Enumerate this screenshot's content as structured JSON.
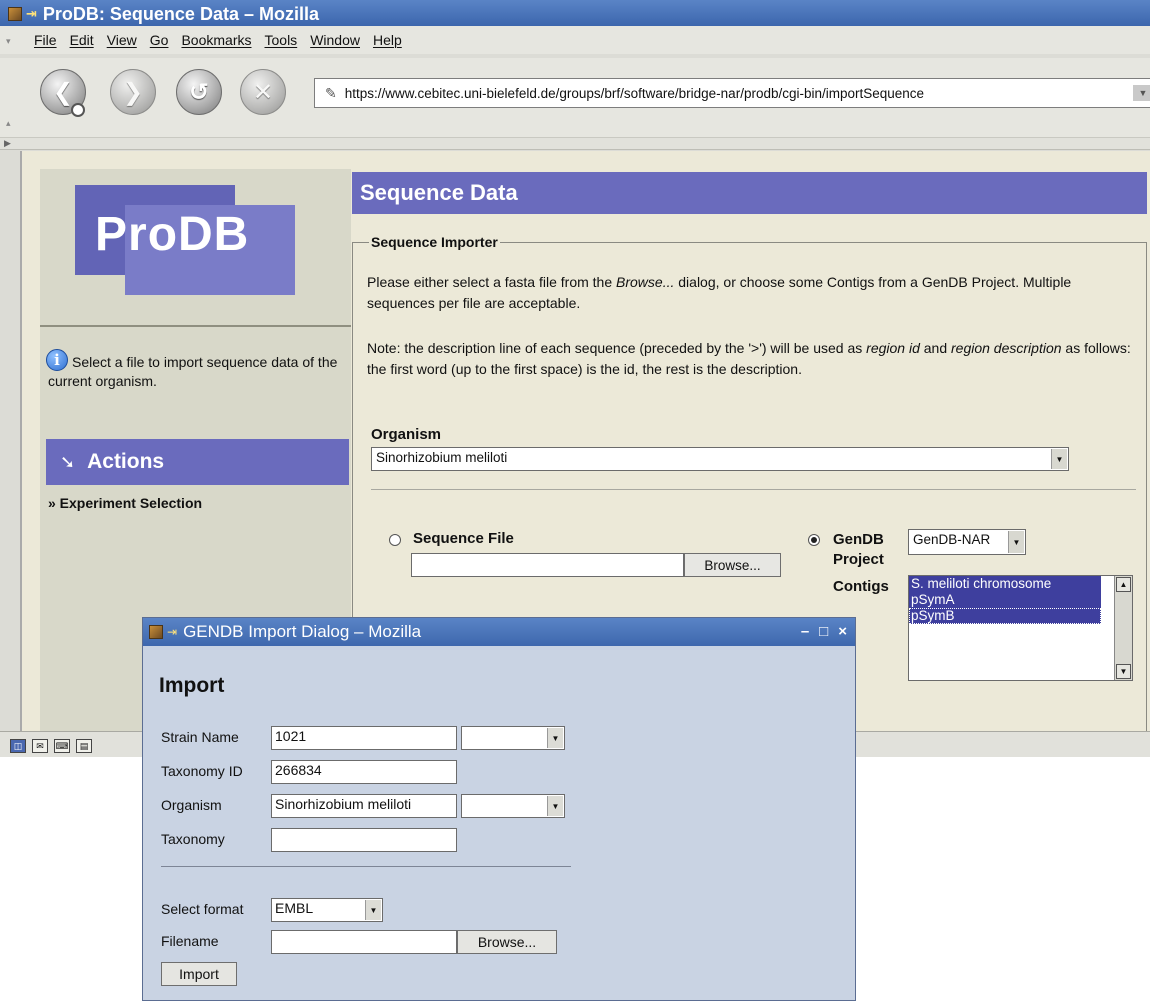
{
  "browser": {
    "title": "ProDB: Sequence Data – Mozilla",
    "menu": [
      "File",
      "Edit",
      "View",
      "Go",
      "Bookmarks",
      "Tools",
      "Window",
      "Help"
    ],
    "url": "https://www.cebitec.uni-bielefeld.de/groups/brf/software/bridge-nar/prodb/cgi-bin/importSequence"
  },
  "sidebar": {
    "logo_text": "ProDB",
    "info_text": "Select a file to import sequence data of the current organism.",
    "actions_label": "Actions",
    "action_links": [
      "» Experiment Selection"
    ]
  },
  "main": {
    "heading": "Sequence Data",
    "importer_legend": "Sequence Importer",
    "intro_before": "Please either select a fasta file from the ",
    "intro_emph": "Browse...",
    "intro_after": " dialog, or choose some Contigs from a GenDB Project. Multiple sequences per file are acceptable.",
    "note_part1": "Note: the description line of each sequence (preceded by the '>') will be used as ",
    "note_emph1": "region id",
    "note_part2": " and ",
    "note_emph2": "region description",
    "note_part3": " as follows: the first word (up to the first space) is the id, the rest is the description.",
    "organism_label": "Organism",
    "organism_value": "Sinorhizobium meliloti",
    "sequence_file_label": "Sequence File",
    "sequence_file_value": "",
    "browse_label": "Browse...",
    "gendb_label_line1": "GenDB",
    "gendb_label_line2": "Project",
    "gendb_value": "GenDB-NAR",
    "contigs_label": "Contigs",
    "contigs": [
      "S. meliloti chromosome",
      "pSymA",
      "pSymB"
    ]
  },
  "dialog": {
    "title": "GENDB Import Dialog – Mozilla",
    "heading": "Import",
    "strain_label": "Strain Name",
    "strain_value": "1021",
    "taxid_label": "Taxonomy ID",
    "taxid_value": "266834",
    "organism_label": "Organism",
    "organism_value": "Sinorhizobium meliloti",
    "taxonomy_label": "Taxonomy",
    "taxonomy_value": "",
    "format_label": "Select format",
    "format_value": "EMBL",
    "filename_label": "Filename",
    "filename_value": "",
    "browse_label": "Browse...",
    "import_label": "Import"
  },
  "colors": {
    "accent": "#6a6bbd",
    "titlebar": "#4a75bb",
    "dialog_bg": "#c9d3e3",
    "page_bg": "#ece9d8"
  }
}
